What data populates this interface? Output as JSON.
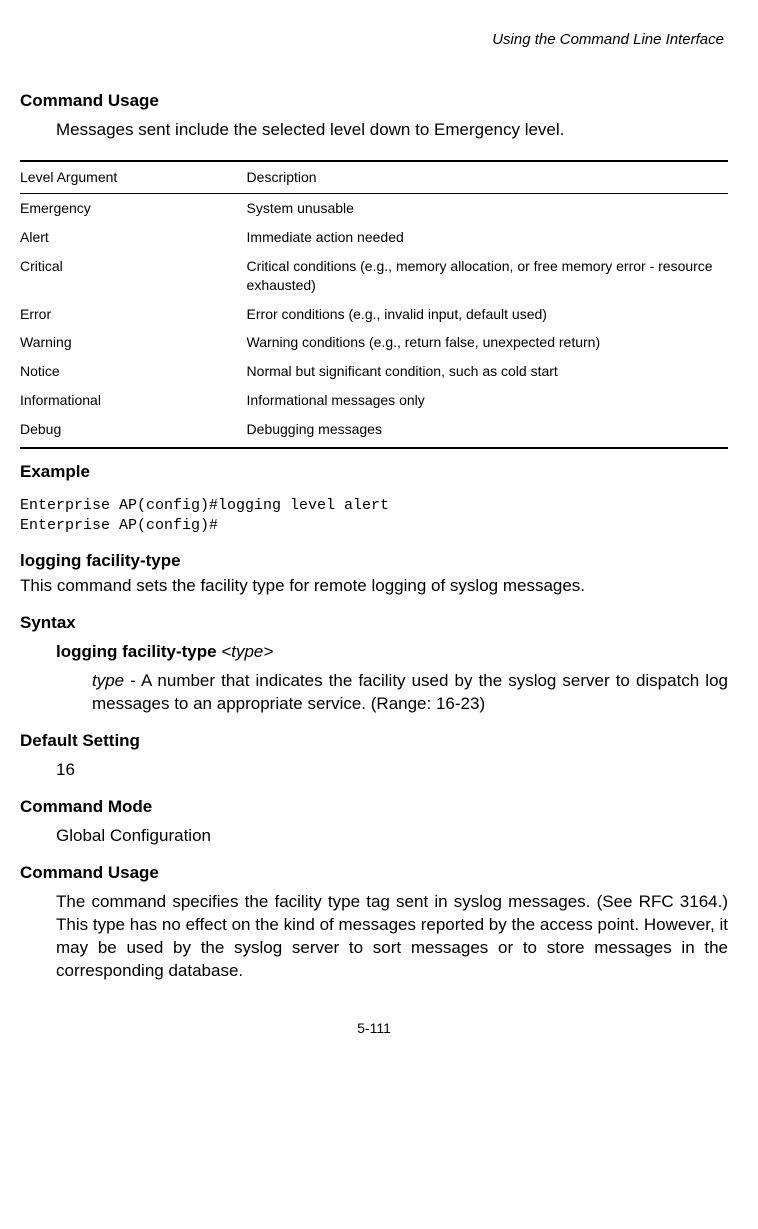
{
  "header": {
    "running": "Using the Command Line Interface"
  },
  "section1": {
    "title": "Command Usage",
    "body": "Messages sent include the selected level down to Emergency level."
  },
  "table": {
    "head": {
      "c1": "Level Argument",
      "c2": "Description"
    },
    "rows": [
      {
        "c1": "Emergency",
        "c2": "System unusable"
      },
      {
        "c1": "Alert",
        "c2": "Immediate action needed"
      },
      {
        "c1": "Critical",
        "c2": "Critical conditions (e.g., memory allocation, or free memory error - resource exhausted)"
      },
      {
        "c1": "Error",
        "c2": "Error conditions (e.g., invalid input, default used)"
      },
      {
        "c1": "Warning",
        "c2": "Warning conditions (e.g., return false, unexpected return)"
      },
      {
        "c1": "Notice",
        "c2": "Normal but significant condition, such as cold start"
      },
      {
        "c1": "Informational",
        "c2": "Informational messages only"
      },
      {
        "c1": "Debug",
        "c2": "Debugging messages"
      }
    ]
  },
  "example": {
    "title": "Example",
    "cli": "Enterprise AP(config)#logging level alert\nEnterprise AP(config)#"
  },
  "cmd": {
    "name": "logging facility-type",
    "desc": "This command sets the facility type for remote logging of syslog messages.",
    "syntax_title": "Syntax",
    "syntax_bold": "logging facility-type",
    "syntax_arg": "<type>",
    "type_label": "type",
    "type_desc": " - A number that indicates the facility used by the syslog server to dispatch log messages to an appropriate service. (Range: 16-23)",
    "default_title": "Default Setting",
    "default_val": "16",
    "mode_title": "Command Mode",
    "mode_val": "Global Configuration",
    "usage_title": "Command Usage",
    "usage_body": "The command specifies the facility type tag sent in syslog messages. (See RFC 3164.) This type has no effect on the kind of messages reported by the access point. However, it may be used by the syslog server to sort messages or to store messages in the corresponding database."
  },
  "footer": {
    "page": "5-111"
  }
}
